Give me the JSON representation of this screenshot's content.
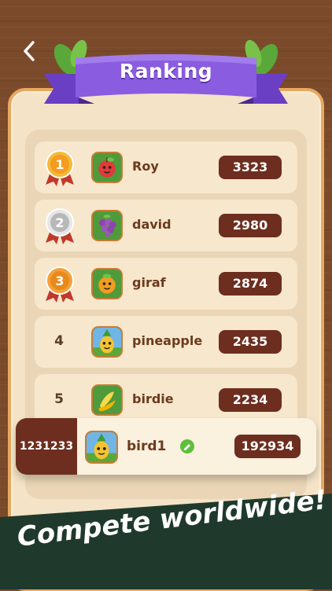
{
  "header": {
    "title": "Ranking",
    "back_icon": "chevron-left-icon"
  },
  "rankings": [
    {
      "rank": "1",
      "name": "Roy",
      "score": "3323",
      "medal": "gold",
      "fruit": "apple"
    },
    {
      "rank": "2",
      "name": "david",
      "score": "2980",
      "medal": "silver",
      "fruit": "grapes"
    },
    {
      "rank": "3",
      "name": "giraf",
      "score": "2874",
      "medal": "bronze",
      "fruit": "orange"
    },
    {
      "rank": "4",
      "name": "pineapple",
      "score": "2435",
      "medal": "none",
      "fruit": "pineapple"
    },
    {
      "rank": "5",
      "name": "birdie",
      "score": "2234",
      "medal": "none",
      "fruit": "banana"
    }
  ],
  "current_user": {
    "rank": "1231233",
    "name": "bird1",
    "score": "192934",
    "fruit": "pineapple",
    "edit_icon": "pencil-icon"
  },
  "promo": {
    "text": "Compete worldwide!"
  },
  "colors": {
    "accent_purple": "#8a5ce0",
    "score_bg": "#6d2e1f",
    "panel_bg": "#f4e3c6",
    "gold": "#f5a623",
    "silver": "#c8c8c8",
    "bronze": "#e8891c",
    "promo_bg": "#1f3a2c"
  }
}
